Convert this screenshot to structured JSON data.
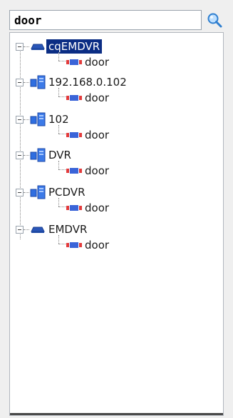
{
  "search": {
    "value": "door"
  },
  "tree": {
    "nodes": [
      {
        "label": "cqEMDVR",
        "icon": "dvr-device-icon",
        "selected": true,
        "children": [
          {
            "label": "door",
            "icon": "door-sensor-icon"
          }
        ]
      },
      {
        "label": "192.168.0.102",
        "icon": "camera-server-icon",
        "children": [
          {
            "label": "door",
            "icon": "door-sensor-icon"
          }
        ]
      },
      {
        "label": "102",
        "icon": "camera-server-icon",
        "children": [
          {
            "label": "door",
            "icon": "door-sensor-icon"
          }
        ]
      },
      {
        "label": "DVR",
        "icon": "camera-server-icon",
        "children": [
          {
            "label": "door",
            "icon": "door-sensor-icon"
          }
        ]
      },
      {
        "label": "PCDVR",
        "icon": "camera-server-icon",
        "children": [
          {
            "label": "door",
            "icon": "door-sensor-icon"
          }
        ]
      },
      {
        "label": "EMDVR",
        "icon": "dvr-device-icon",
        "children": [
          {
            "label": "door",
            "icon": "door-sensor-icon"
          }
        ]
      }
    ]
  }
}
